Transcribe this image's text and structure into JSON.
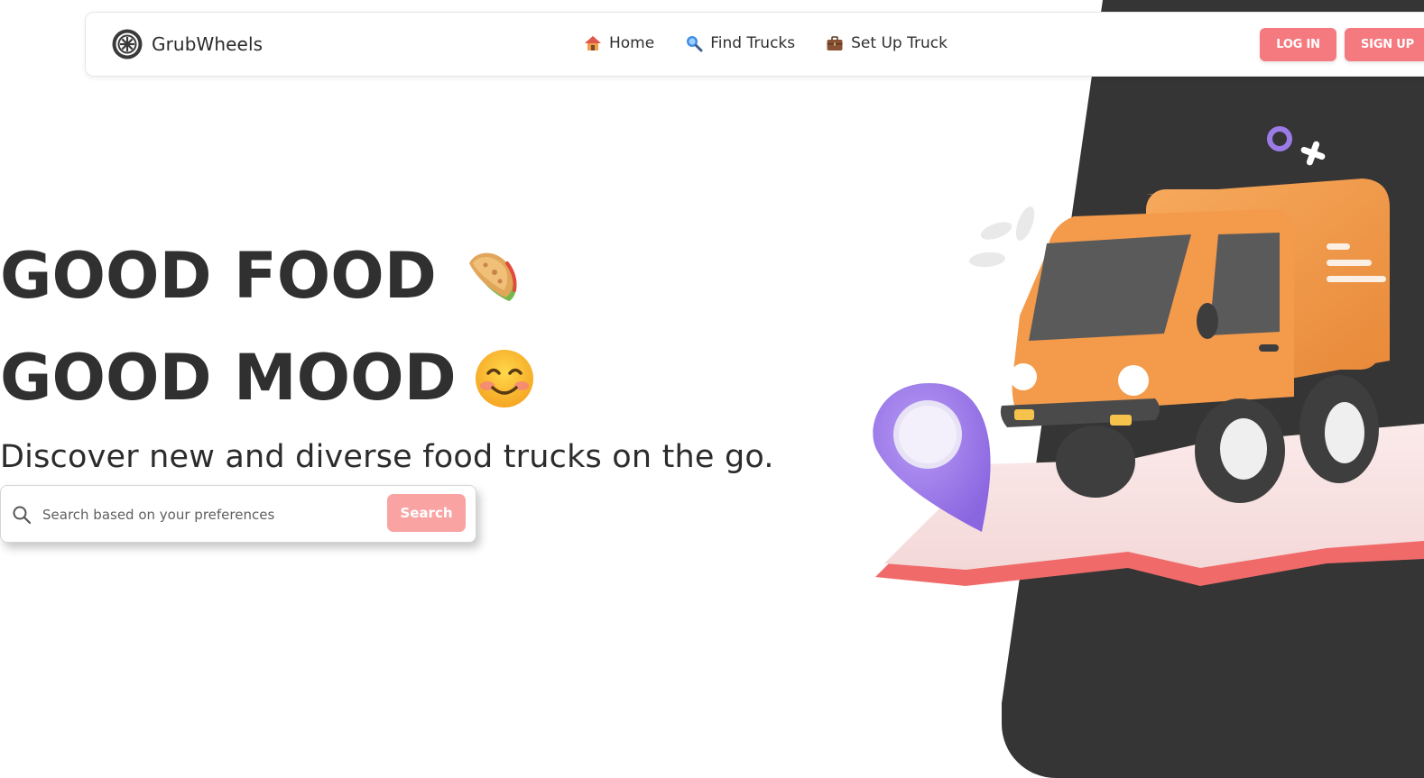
{
  "nav": {
    "brand_name": "GrubWheels",
    "links": [
      {
        "label": "Home",
        "icon": "house-icon"
      },
      {
        "label": "Find Trucks",
        "icon": "magnifier-icon"
      },
      {
        "label": "Set Up Truck",
        "icon": "briefcase-icon"
      }
    ],
    "login_label": "LOG IN",
    "signup_label": "SIGN UP"
  },
  "hero": {
    "line1": "GOOD FOOD",
    "line1_emoji": "taco-icon",
    "line2": "GOOD MOOD",
    "line2_emoji": "smiling-face-icon",
    "subtitle": "Discover new and diverse food trucks on the go."
  },
  "search": {
    "placeholder": "Search based on your preferences",
    "value": "",
    "button_label": "Search"
  },
  "colors": {
    "accent": "#f57a7f",
    "accent_light": "#f9a3a3",
    "dark_panel": "#353535",
    "truck_orange": "#f39a4b",
    "pin_purple": "#9b7be6"
  }
}
